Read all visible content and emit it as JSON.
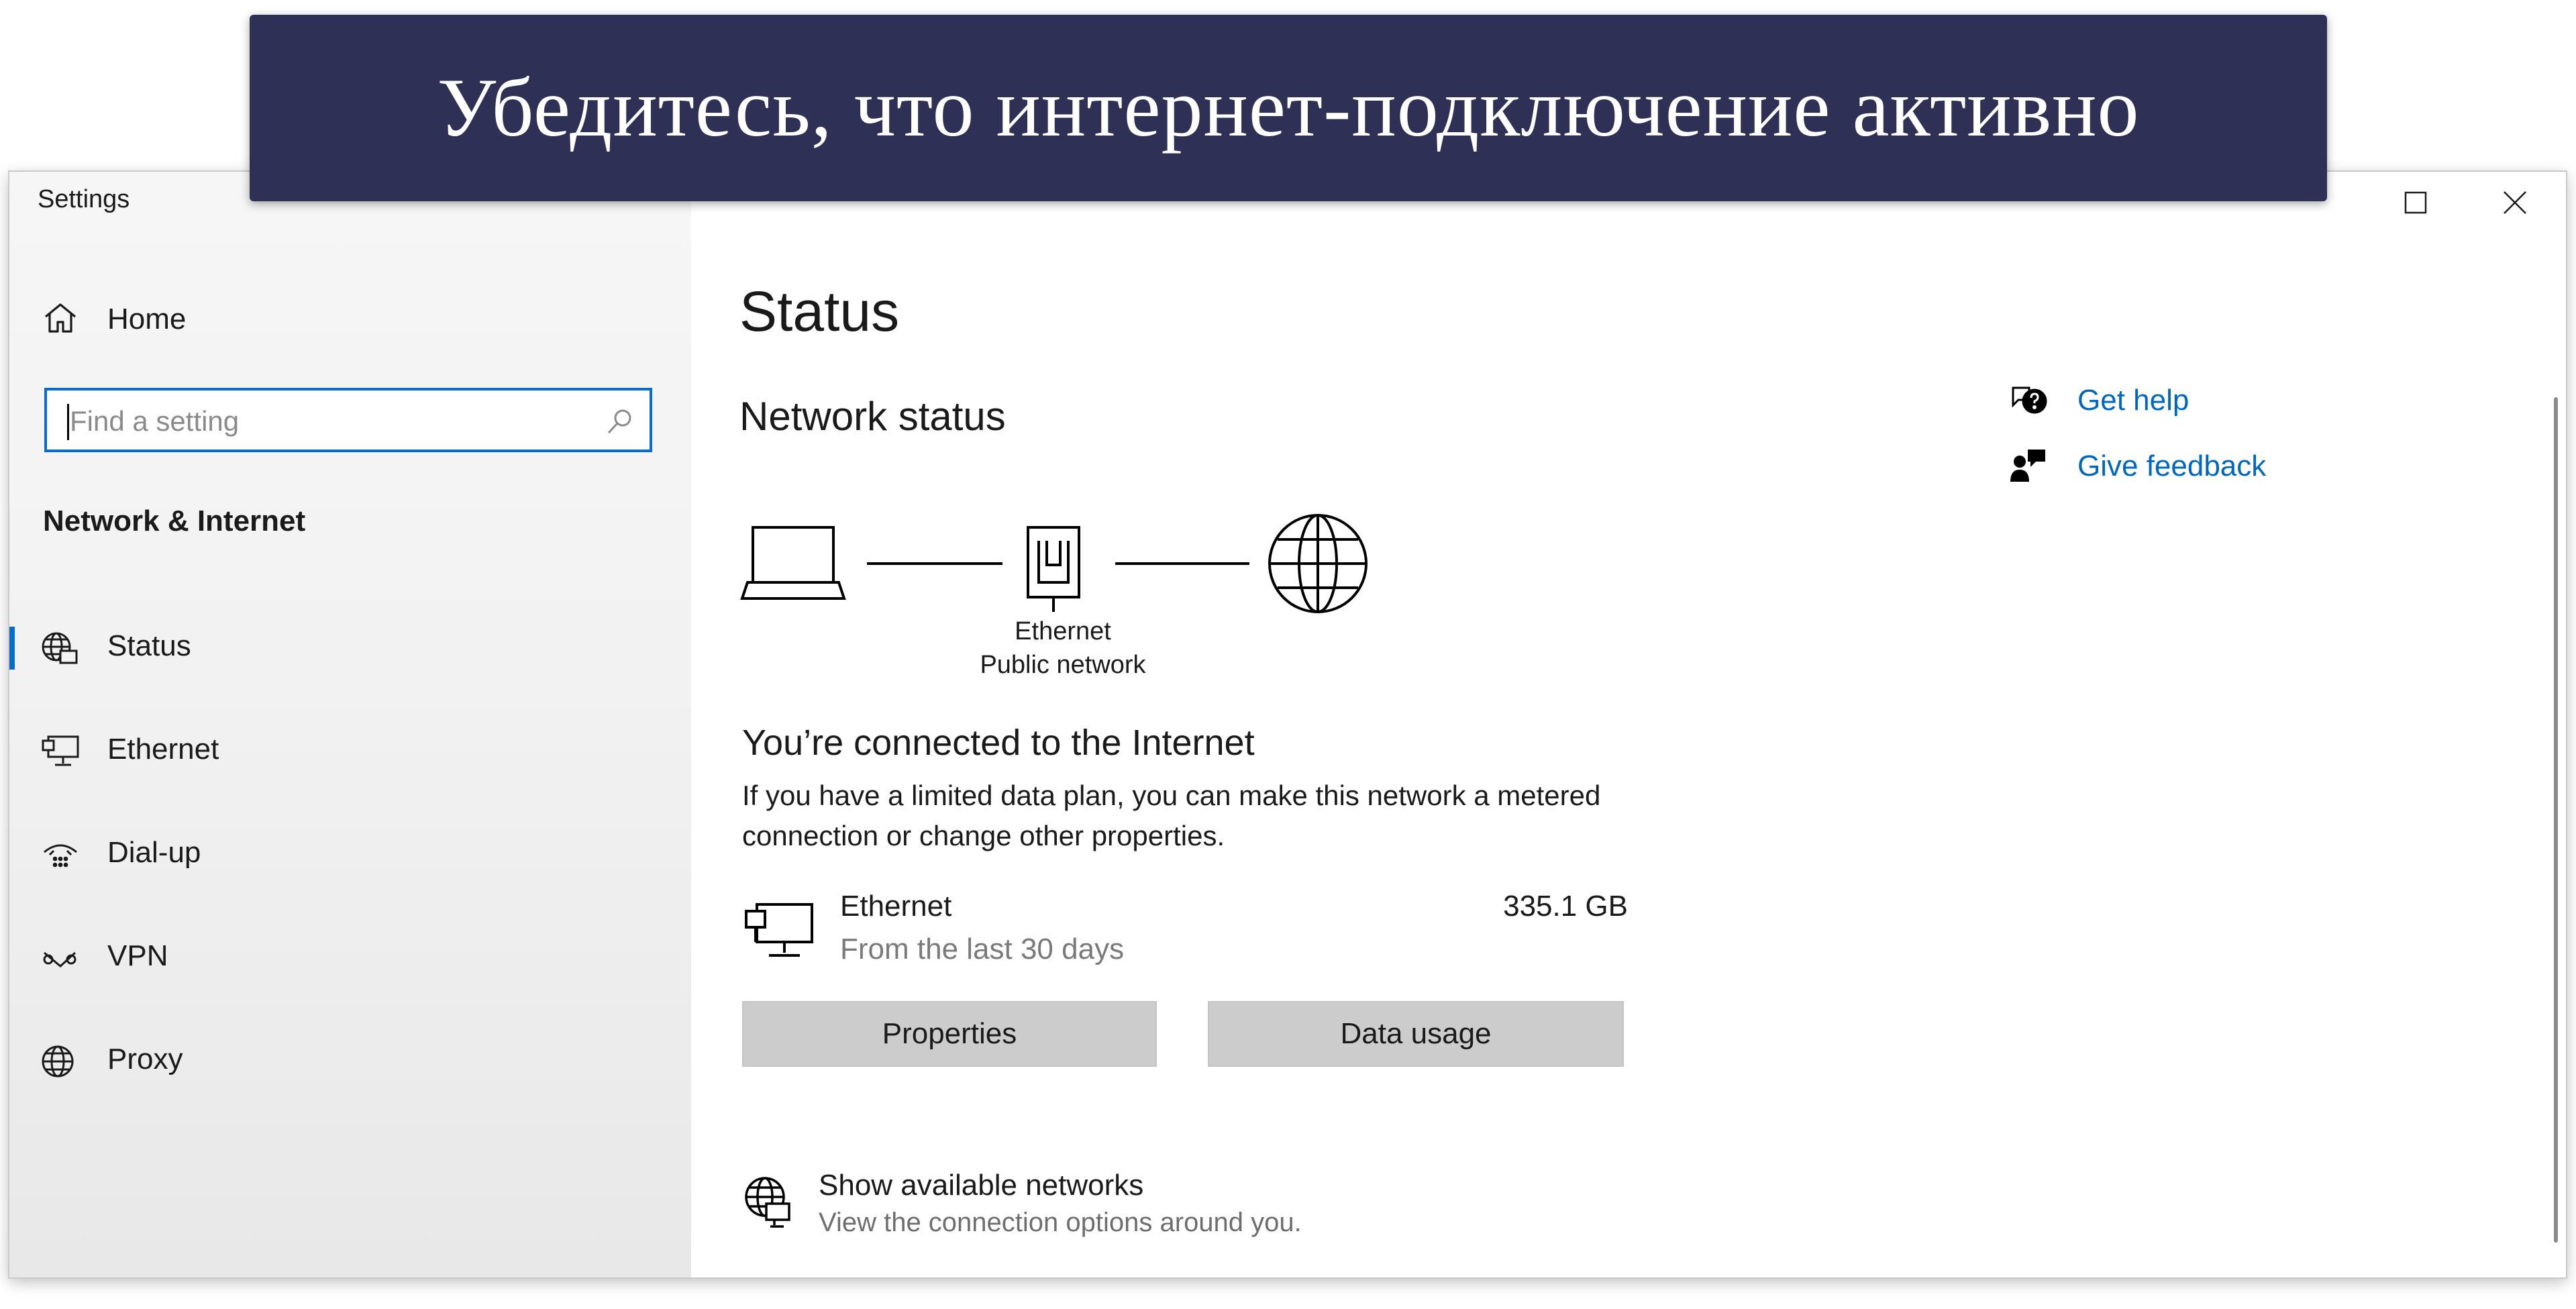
{
  "banner": {
    "text": "Убедитесь, что интернет-подключение активно"
  },
  "window": {
    "title": "Settings"
  },
  "sidebar": {
    "home_label": "Home",
    "search": {
      "placeholder": "Find a setting"
    },
    "section_title": "Network & Internet",
    "items": [
      {
        "label": "Status",
        "icon": "globe-status-icon",
        "selected": true
      },
      {
        "label": "Ethernet",
        "icon": "ethernet-icon",
        "selected": false
      },
      {
        "label": "Dial-up",
        "icon": "dialup-icon",
        "selected": false
      },
      {
        "label": "VPN",
        "icon": "vpn-icon",
        "selected": false
      },
      {
        "label": "Proxy",
        "icon": "globe-icon",
        "selected": false
      }
    ]
  },
  "main": {
    "title": "Status",
    "network_status": "Network status",
    "diagram": {
      "adapter_name": "Ethernet",
      "network_type": "Public network"
    },
    "connected_text": "You’re connected to the Internet",
    "description": "If you have a limited data plan, you can make this network a metered connection or change other properties.",
    "ethernet": {
      "name": "Ethernet",
      "subtitle": "From the last 30 days",
      "usage": "335.1 GB"
    },
    "buttons": {
      "properties": "Properties",
      "data_usage": "Data usage"
    },
    "available": {
      "title": "Show available networks",
      "subtitle": "View the connection options around you."
    }
  },
  "help": {
    "get_help": "Get help",
    "give_feedback": "Give feedback"
  },
  "colors": {
    "accent": "#0a6cc9",
    "link": "#0067c0",
    "banner_bg": "#2f3055"
  }
}
